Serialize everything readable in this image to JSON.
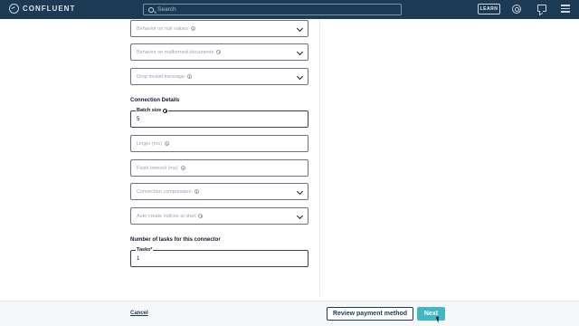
{
  "header": {
    "logo_text": "CONFLUENT",
    "search_placeholder": "Search",
    "learn_label": "LEARN"
  },
  "form": {
    "selects_top": [
      {
        "label": "Behavior on null values"
      },
      {
        "label": "Behavior on malformed documents"
      },
      {
        "label": "Drop invalid message"
      }
    ],
    "connection_details_title": "Connection Details",
    "batch_size": {
      "label": "Batch size",
      "value": "5"
    },
    "linger": {
      "label": "Linger (ms)"
    },
    "flush_timeout": {
      "label": "Flush timeout (ms)"
    },
    "connection_compression": {
      "label": "Connection compression"
    },
    "auto_create_indices": {
      "label": "Auto create indices at start"
    },
    "tasks_title": "Number of tasks for this connector",
    "tasks": {
      "label": "Tasks*",
      "value": "1"
    }
  },
  "footer": {
    "cancel_label": "Cancel",
    "review_label": "Review payment method",
    "next_label": "Next"
  },
  "colors": {
    "topbar": "#1d3a54",
    "accent": "#40b7c7",
    "footer_bg": "#f5f7f8"
  }
}
